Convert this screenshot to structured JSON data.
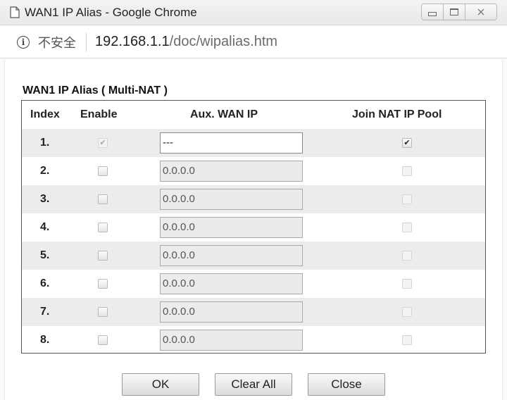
{
  "window": {
    "title": "WAN1 IP Alias - Google Chrome",
    "insecure_label": "不安全",
    "url_host": "192.168.1.1",
    "url_path": "/doc/wipalias.htm"
  },
  "section": {
    "title": "WAN1 IP Alias ( Multi-NAT )"
  },
  "table": {
    "headers": {
      "index": "Index",
      "enable": "Enable",
      "aux_wan_ip": "Aux. WAN IP",
      "join_nat": "Join NAT IP Pool"
    },
    "rows": [
      {
        "index": "1.",
        "enable": true,
        "enable_disabled": true,
        "ip": "---",
        "join_nat": true,
        "join_disabled": false
      },
      {
        "index": "2.",
        "enable": false,
        "enable_disabled": false,
        "ip": "0.0.0.0",
        "join_nat": false,
        "join_disabled": true
      },
      {
        "index": "3.",
        "enable": false,
        "enable_disabled": false,
        "ip": "0.0.0.0",
        "join_nat": false,
        "join_disabled": true
      },
      {
        "index": "4.",
        "enable": false,
        "enable_disabled": false,
        "ip": "0.0.0.0",
        "join_nat": false,
        "join_disabled": true
      },
      {
        "index": "5.",
        "enable": false,
        "enable_disabled": false,
        "ip": "0.0.0.0",
        "join_nat": false,
        "join_disabled": true
      },
      {
        "index": "6.",
        "enable": false,
        "enable_disabled": false,
        "ip": "0.0.0.0",
        "join_nat": false,
        "join_disabled": true
      },
      {
        "index": "7.",
        "enable": false,
        "enable_disabled": false,
        "ip": "0.0.0.0",
        "join_nat": false,
        "join_disabled": true
      },
      {
        "index": "8.",
        "enable": false,
        "enable_disabled": false,
        "ip": "0.0.0.0",
        "join_nat": false,
        "join_disabled": true
      }
    ]
  },
  "buttons": {
    "ok": "OK",
    "clear_all": "Clear All",
    "close": "Close"
  },
  "icons": {
    "page": "page-icon",
    "info": "info-icon",
    "check": "✔"
  }
}
